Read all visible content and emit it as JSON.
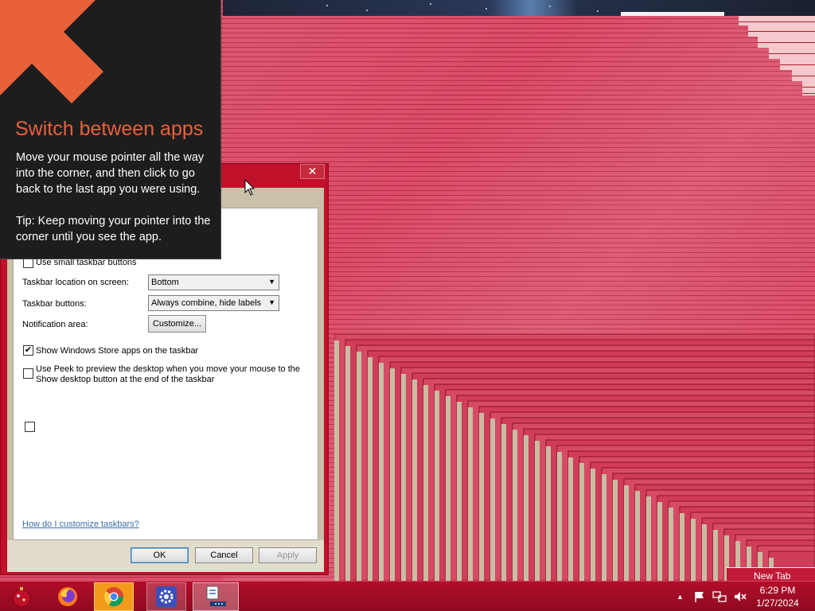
{
  "tip": {
    "title": "Switch between apps",
    "body": "Move your mouse pointer all the way into the corner, and then click to go back to the last app you were using.",
    "tip_line": "Tip: Keep moving your pointer into the corner until you see the app."
  },
  "dialog": {
    "options": {
      "small_buttons_label": "Use small taskbar buttons",
      "small_buttons_checked": false,
      "location_label": "Taskbar location on screen:",
      "location_value": "Bottom",
      "buttons_label": "Taskbar buttons:",
      "buttons_value": "Always combine, hide labels",
      "notification_label": "Notification area:",
      "customize_label": "Customize...",
      "store_apps_label": "Show Windows Store apps on the taskbar",
      "store_apps_checked": true,
      "peek_label_line1": "Use Peek to preview the desktop when you move your mouse to the",
      "peek_label_line2": "Show desktop button at the end of the taskbar",
      "peek_checked": false
    },
    "help_link": "How do I customize taskbars?",
    "ok_label": "OK",
    "cancel_label": "Cancel",
    "apply_label": "Apply",
    "close_glyph": "✕"
  },
  "taskbar": {
    "apps": [
      "start-ornament-icon",
      "firefox-icon",
      "chrome-icon",
      "settings-icon",
      "task-manager-icon"
    ],
    "clock_time": "6:29 PM",
    "clock_date": "1/27/2024"
  },
  "notification": {
    "label": "New Tab"
  },
  "colors": {
    "accent": "#e8613b",
    "taskbar": "#b20d2a",
    "dialog_frame": "#c0102a"
  }
}
